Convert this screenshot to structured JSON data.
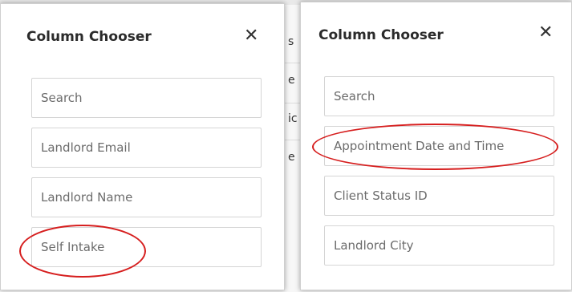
{
  "background": {
    "fragments": [
      "s",
      "e",
      "ic",
      "e"
    ]
  },
  "left_panel": {
    "title": "Column Chooser",
    "close_glyph": "✕",
    "search_placeholder": "Search",
    "items": [
      "Landlord Email",
      "Landlord Name",
      "Self Intake"
    ]
  },
  "right_panel": {
    "title": "Column Chooser",
    "close_glyph": "✕",
    "search_placeholder": "Search",
    "items": [
      "Appointment Date and Time",
      "Client Status ID",
      "Landlord City"
    ]
  },
  "colors": {
    "annotation": "#d61e1e"
  }
}
